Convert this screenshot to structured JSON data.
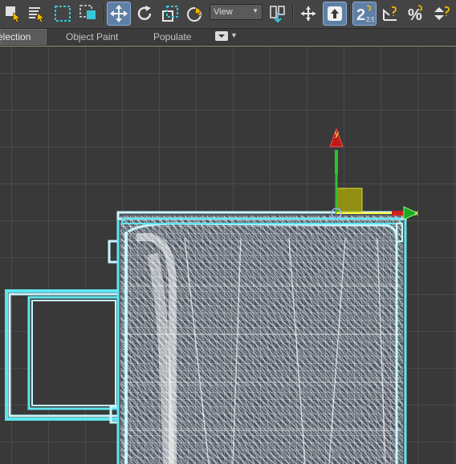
{
  "toolbar": {
    "view_dropdown": "View",
    "icons": [
      "select-object-icon",
      "select-by-name-icon",
      "rectangular-selection-region-icon",
      "window-crossing-icon",
      "select-and-move-icon",
      "select-and-rotate-icon",
      "select-and-scale-icon",
      "selection-filter-icon",
      "use-pivot-center-icon",
      "select-and-manipulate-icon",
      "keyboard-shortcut-override-icon",
      "snaps-toggle-icon",
      "angle-snap-icon",
      "percent-snap-icon",
      "spinner-snap-icon"
    ],
    "snap_label": "2.5"
  },
  "ribbon": {
    "tabs": [
      "election",
      "Object Paint",
      "Populate"
    ]
  },
  "gizmo": {
    "x_label": "x",
    "y_label": "y"
  },
  "colors": {
    "wireframe": "#c8f7ff",
    "wireframe_edge": "#5ee6f0",
    "gizmo_x": "#d11f1f",
    "gizmo_y": "#1fa81f",
    "gizmo_plane": "#c8c400",
    "active_button": "#5e7fa6"
  }
}
